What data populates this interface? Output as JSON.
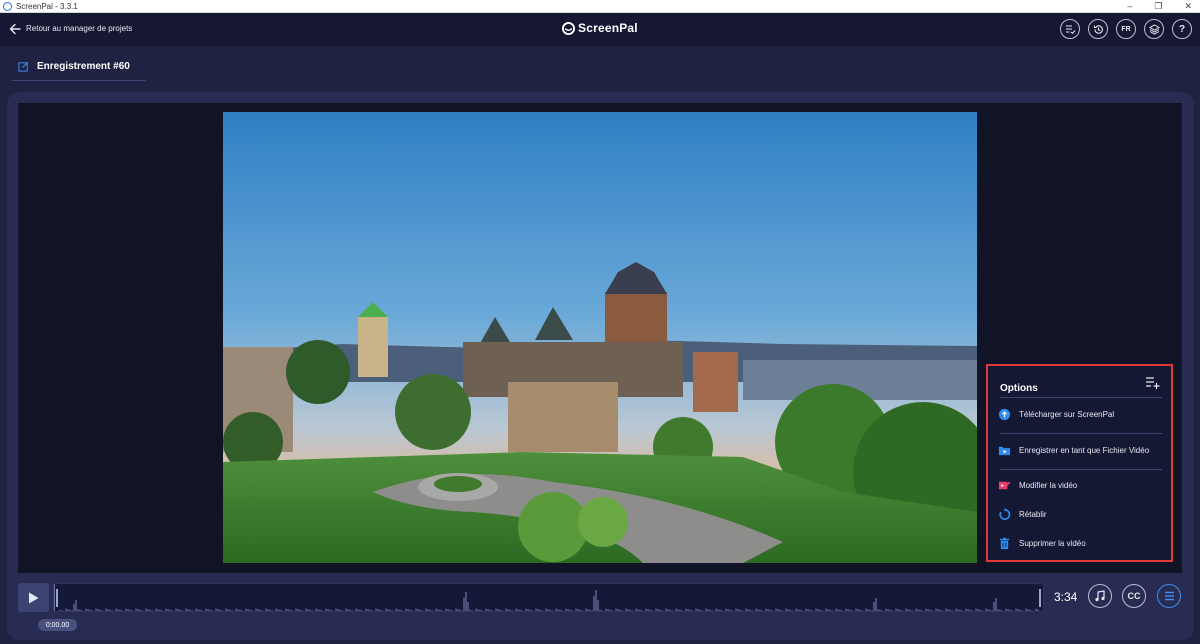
{
  "window": {
    "title": "ScreenPal - 3.3.1",
    "controls": [
      "–",
      "❐",
      "✕"
    ]
  },
  "header": {
    "back_label": "Retour au manager de projets",
    "brand": "ScreenPal",
    "language": "FR",
    "help": "?"
  },
  "project": {
    "title": "Enregistrement #60"
  },
  "options_menu": {
    "title": "Options",
    "items": [
      {
        "label": "Télécharger sur ScreenPal",
        "icon": "upload-cloud-icon",
        "color": "#2d8cf0"
      },
      {
        "label": "Enregistrer en tant que Fichier Vidéo",
        "icon": "save-video-file-icon",
        "color": "#2d8cf0"
      },
      {
        "label": "Modifier la vidéo",
        "icon": "edit-video-icon",
        "color": "#e83e6c"
      },
      {
        "label": "Rétablir",
        "icon": "restore-icon",
        "color": "#2d8cf0"
      },
      {
        "label": "Supprimer la vidéo",
        "icon": "trash-icon",
        "color": "#2d8cf0"
      }
    ]
  },
  "player": {
    "duration": "3:34",
    "current_time": "0:00.00",
    "cc_label": "CC"
  },
  "colors": {
    "accent": "#3f8cf0",
    "highlight_border": "#e0393a",
    "background": "#1f2240"
  }
}
